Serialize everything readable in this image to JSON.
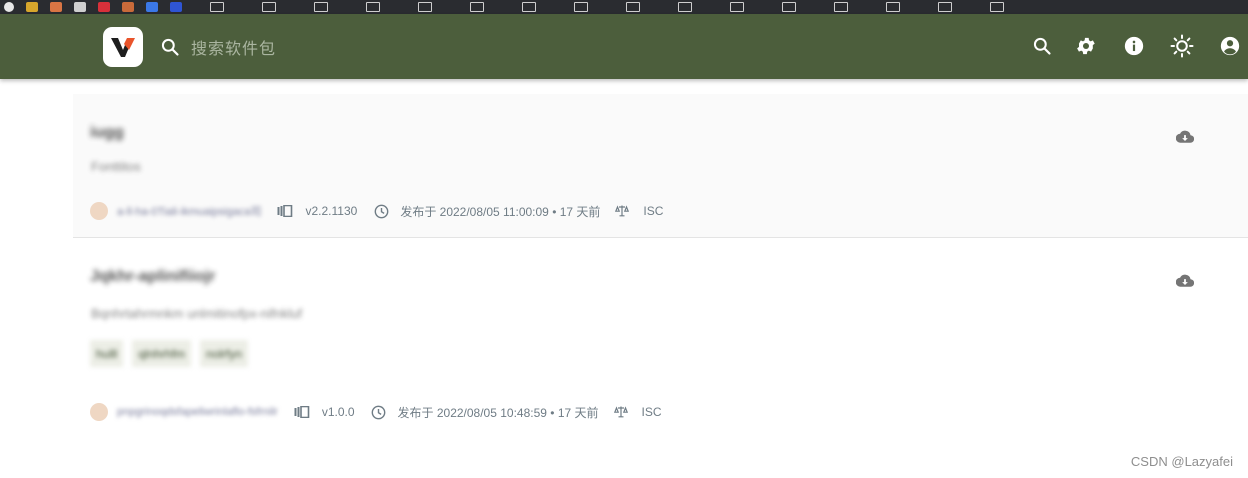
{
  "header": {
    "search": {
      "placeholder": "搜索软件包"
    },
    "actions": [
      {
        "id": "search",
        "icon": "search-icon"
      },
      {
        "id": "settings",
        "icon": "gear-icon"
      },
      {
        "id": "info",
        "icon": "info-icon"
      },
      {
        "id": "theme",
        "icon": "sun-icon"
      },
      {
        "id": "account",
        "icon": "account-circle-icon"
      }
    ],
    "bar_color": "#4c5e3c"
  },
  "packages": [
    {
      "name": "iugg",
      "description": "Fonttitos",
      "publisher": "a-ll-ha-0Tiali-ikmuaipsigaca司",
      "version": "v2.2.1130",
      "published": "发布于 2022/08/05 11:00:09 • 17 天前",
      "license": "ISC",
      "tags": []
    },
    {
      "name": "Jqkhr-aplinifiiojr",
      "description": "Bqnhrtahrmnkm unlmitinofpx-nifnkluf",
      "publisher": "pnpgrinoqdsfapeliwrinlaflo-fsfrnilr",
      "version": "v1.0.0",
      "published": "发布于 2022/08/05 10:48:59 • 17 天前",
      "license": "ISC",
      "tags": [
        "hulll",
        "qlnhrhfm",
        "nolrfyn"
      ]
    }
  ],
  "footer": {
    "watermark": "CSDN @Lazyafei"
  }
}
